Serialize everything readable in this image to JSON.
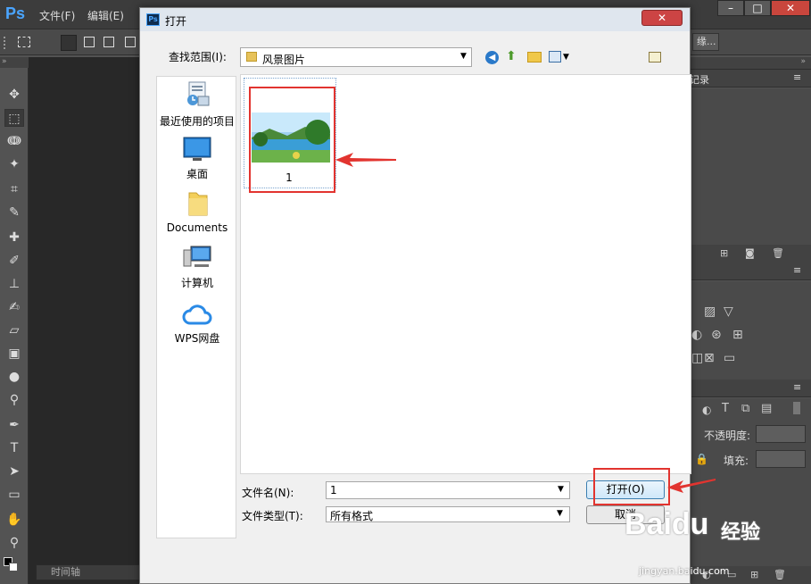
{
  "ps": {
    "logo": "Ps",
    "menu": [
      "文件(F)",
      "编辑(E)"
    ],
    "right_button_fragment": "缘...",
    "history_tab_fragment": "记录",
    "opacity_label": "不透明度:",
    "fill_label": "填充:",
    "timeline_label": "时间轴"
  },
  "dialog": {
    "title": "打开",
    "look_in_label": "查找范围(I):",
    "look_in_value": "风景图片",
    "nav_items": [
      {
        "label": "最近使用的项目",
        "icon": "recent-items-icon"
      },
      {
        "label": "桌面",
        "icon": "desktop-icon"
      },
      {
        "label": "Documents",
        "icon": "folder-icon"
      },
      {
        "label": "计算机",
        "icon": "computer-icon"
      },
      {
        "label": "WPS网盘",
        "icon": "cloud-icon"
      }
    ],
    "files": [
      {
        "name": "1",
        "icon": "landscape-thumbnail-icon"
      }
    ],
    "filename_label": "文件名(N):",
    "filename_value": "1",
    "filetype_label": "文件类型(T):",
    "filetype_value": "所有格式",
    "open_button": "打开(O)",
    "cancel_button": "取消"
  },
  "watermark": {
    "brand": "Baidu",
    "product": "经验",
    "url": "jingyan.baidu.com"
  },
  "colors": {
    "annotation_red": "#e2342f",
    "ps_blue": "#4aa5ff"
  }
}
